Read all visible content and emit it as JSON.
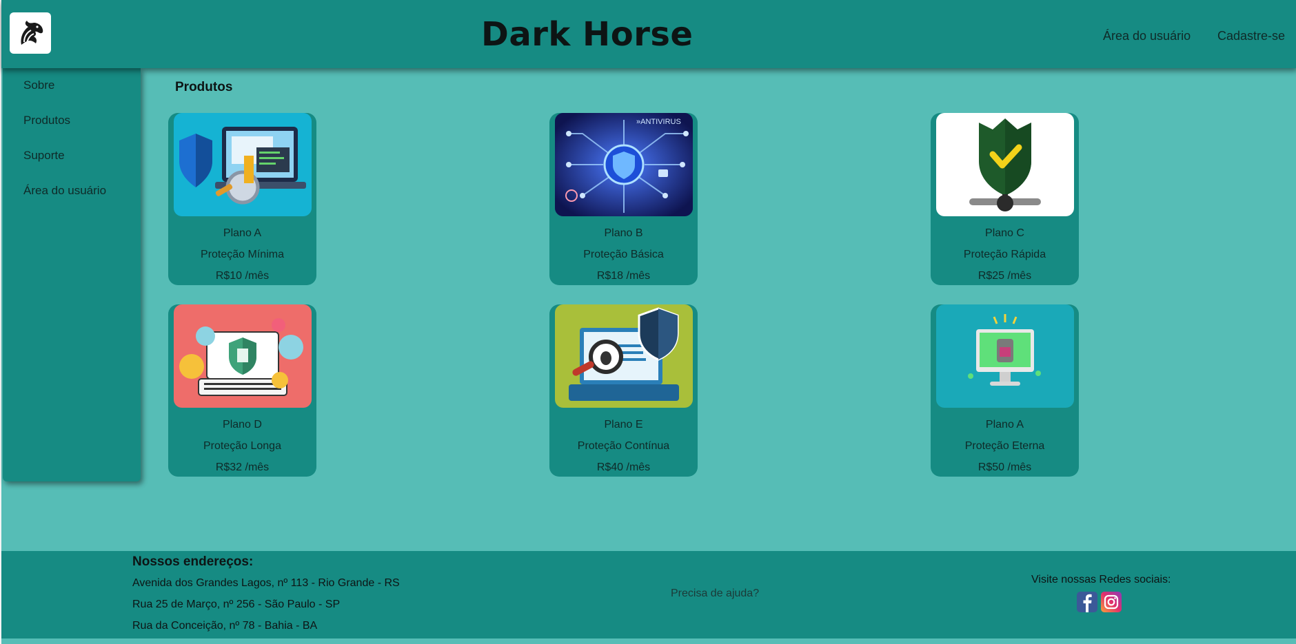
{
  "header": {
    "title": "Dark Horse",
    "links": [
      "Área do usuário",
      "Cadastre-se"
    ]
  },
  "sidebar": {
    "items": [
      "Sobre",
      "Produtos",
      "Suporte",
      "Área do usuário"
    ]
  },
  "products": {
    "title": "Produtos",
    "items": [
      {
        "name": "Plano A",
        "desc": "Proteção Mínima",
        "price": "R$10 /mês",
        "icon": "security-laptop-icon"
      },
      {
        "name": "Plano B",
        "desc": "Proteção Básica",
        "price": "R$18 /mês",
        "icon": "antivirus-circuit-icon"
      },
      {
        "name": "Plano C",
        "desc": "Proteção Rápida",
        "price": "R$25 /mês",
        "icon": "shield-check-icon"
      },
      {
        "name": "Plano D",
        "desc": "Proteção Longa",
        "price": "R$32 /mês",
        "icon": "shield-laptop-icon"
      },
      {
        "name": "Plano E",
        "desc": "Proteção Contínua",
        "price": "R$40 /mês",
        "icon": "bug-scan-laptop-icon"
      },
      {
        "name": "Plano A",
        "desc": "Proteção Eterna",
        "price": "R$50 /mês",
        "icon": "monitor-lock-icon"
      }
    ]
  },
  "footer": {
    "addresses_title": "Nossos endereços:",
    "addresses": [
      "Avenida dos Grandes Lagos, nº 113 - Rio Grande - RS",
      "Rua 25 de Março, nº 256 - São Paulo - SP",
      "Rua da Conceição, nº 78 - Bahia - BA"
    ],
    "help": "Precisa de ajuda?",
    "social_title": "Visite nossas Redes sociais:",
    "social": [
      "facebook-icon",
      "instagram-icon"
    ]
  },
  "colors": {
    "background": "#56bdb6",
    "header": "#168b83",
    "text": "#0d1414"
  }
}
